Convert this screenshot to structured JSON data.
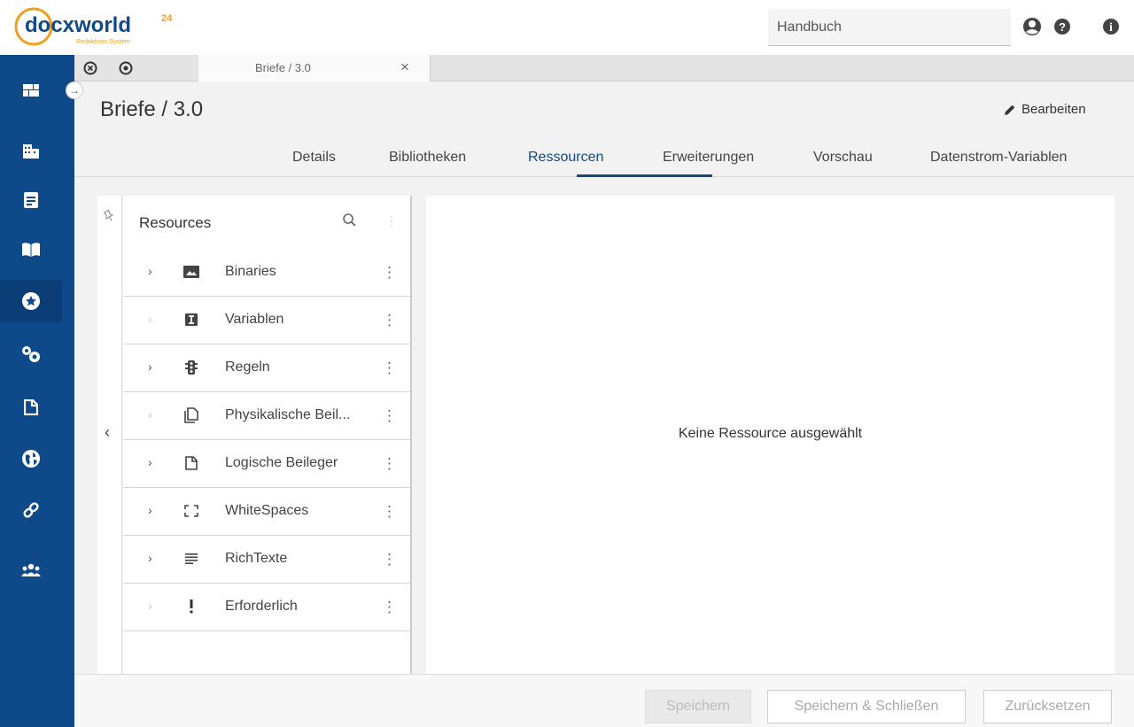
{
  "header": {
    "logo_text": "docxworld",
    "logo_sup": "24",
    "logo_sub": "Redaktions-System",
    "search_value": "Handbuch",
    "icons": [
      "user-circle-icon",
      "help-icon",
      "info-icon"
    ]
  },
  "colors": {
    "nav_bg": "#0e4a8a",
    "accent": "#0e4a8a",
    "logo_orange": "#f0a020"
  },
  "nav": {
    "items": [
      "dashboard-icon",
      "buildings-icon",
      "document-icon",
      "book-icon",
      "star-circle-icon",
      "gears-icon",
      "page-icon",
      "globe-icon",
      "link-icon",
      "users-icon"
    ],
    "active_index": 4
  },
  "tabstrip": {
    "doc_tab_label": "Briefe / 3.0",
    "close_glyph": "×"
  },
  "page": {
    "title": "Briefe / 3.0",
    "edit_label": "Bearbeiten"
  },
  "subtabs": {
    "items": [
      "Details",
      "Bibliotheken",
      "Ressourcen",
      "Erweiterungen",
      "Vorschau",
      "Datenstrom-Variablen"
    ],
    "active": "Ressourcen"
  },
  "tree": {
    "title": "Resources",
    "collapse_glyph": "‹",
    "rows": [
      {
        "label": "Binaries",
        "icon": "image-icon",
        "expandable": true
      },
      {
        "label": "Variablen",
        "icon": "variable-icon",
        "expandable": false
      },
      {
        "label": "Regeln",
        "icon": "traffic-light-icon",
        "expandable": true
      },
      {
        "label": "Physikalische Beil...",
        "icon": "copy-pages-icon",
        "expandable": false
      },
      {
        "label": "Logische Beileger",
        "icon": "page-icon",
        "expandable": true
      },
      {
        "label": "WhiteSpaces",
        "icon": "expand-corners-icon",
        "expandable": true
      },
      {
        "label": "RichTexte",
        "icon": "text-lines-icon",
        "expandable": true
      },
      {
        "label": "Erforderlich",
        "icon": "exclamation-icon",
        "expandable": false
      }
    ]
  },
  "detail": {
    "empty_message": "Keine Ressource ausgewählt"
  },
  "footer": {
    "save": "Speichern",
    "save_close": "Speichern & Schließen",
    "reset": "Zurücksetzen"
  }
}
